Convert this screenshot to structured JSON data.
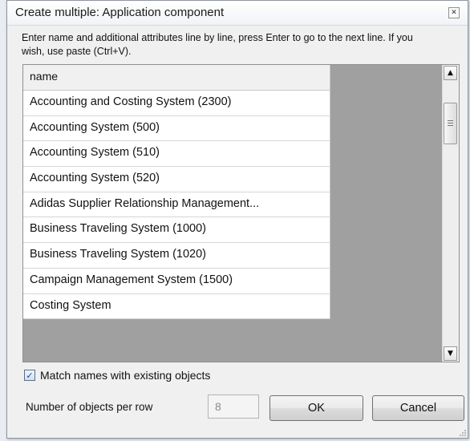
{
  "dialog": {
    "title": "Create multiple: Application component",
    "close_symbol": "✕",
    "instructions": "Enter name and additional attributes line by line, press Enter to go to the next line. If you wish, use paste (Ctrl+V)."
  },
  "grid": {
    "header": "name",
    "rows": [
      "Accounting and Costing System (2300)",
      "Accounting System (500)",
      "Accounting System (510)",
      "Accounting System (520)",
      "Adidas Supplier Relationship Management...",
      "Business Traveling System (1000)",
      "Business Traveling System (1020)",
      "Campaign Management System (1500)",
      "Costing System"
    ],
    "scroll_up_symbol": "▲",
    "scroll_down_symbol": "▼"
  },
  "options": {
    "match_names_label": "Match names with existing objects",
    "match_names_checked": true,
    "check_symbol": "✓",
    "objects_per_row_label": "Number of objects per row",
    "objects_per_row_value": "8"
  },
  "buttons": {
    "ok_label": "OK",
    "cancel_label": "Cancel"
  },
  "icons": {
    "close": "close-icon",
    "scroll_up": "arrow-up-icon",
    "scroll_down": "arrow-down-icon",
    "check": "checkmark-icon",
    "resize": "resize-grip-icon"
  }
}
